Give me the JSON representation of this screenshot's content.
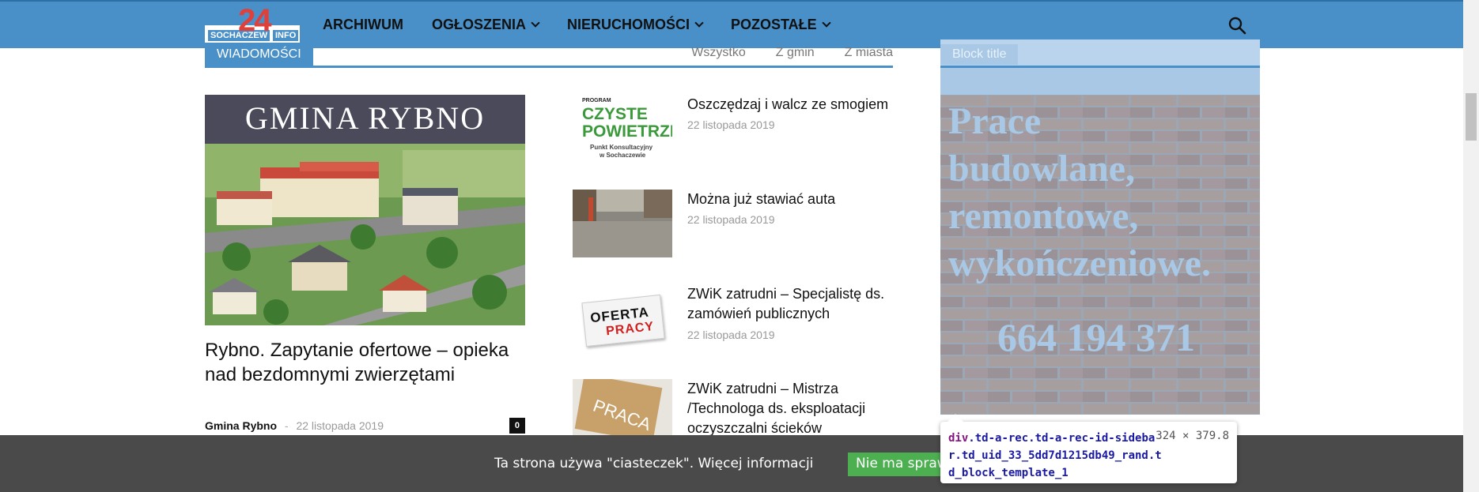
{
  "nav": {
    "logo_number": "24",
    "logo_left": "SOCHACZEW",
    "logo_right": "INFO",
    "items": [
      {
        "label": "ARCHIWUM",
        "dropdown": false
      },
      {
        "label": "OGŁOSZENIA",
        "dropdown": true
      },
      {
        "label": "NIERUCHOMOŚCI",
        "dropdown": true
      },
      {
        "label": "POZOSTAŁE",
        "dropdown": true
      }
    ]
  },
  "section": {
    "tag": "WIADOMOŚCI",
    "filters": [
      "Wszystko",
      "Z gmin",
      "Z miasta"
    ]
  },
  "main_article": {
    "image_caption": "GMINA RYBNO",
    "title": "Rybno. Zapytanie ofertowe – opieka nad bezdomnymi zwierzętami",
    "author": "Gmina Rybno",
    "separator": "-",
    "date": "22 listopada 2019",
    "comments": "0"
  },
  "list": [
    {
      "title": "Oszczędzaj i walcz ze smogiem",
      "date": "22 listopada 2019",
      "thumb_text": [
        "PROGRAM",
        "CZYSTE",
        "POWIETRZE",
        "Punkt Konsultacyjny",
        "w Sochaczewie"
      ]
    },
    {
      "title": "Można już stawiać auta",
      "date": "22 listopada 2019"
    },
    {
      "title": "ZWiK zatrudni – Specjalistę ds. zamówień publicznych",
      "date": "22 listopada 2019",
      "thumb_text": [
        "OFERTA",
        "PRACY"
      ]
    },
    {
      "title": "ZWiK zatrudni – Mistrza /Technologa ds. eksploatacji oczyszczalni ścieków",
      "date": "",
      "thumb_text": [
        "PRACA"
      ]
    }
  ],
  "sidebar": {
    "block_title": "Block title",
    "ad_lines": [
      "Prace",
      "budowlane,",
      "remontowe,",
      "wykończeniowe."
    ],
    "ad_phone": "664 194 371"
  },
  "cookie": {
    "text": "Ta strona używa \"ciasteczek\". Więcej informacji",
    "button": "Nie ma sprawy"
  },
  "devtools_tooltip": {
    "tag": "div",
    "selector": ".td-a-rec.td-a-rec-id-sidebar.td_uid_33_5dd7d1215db49_rand.td_block_template_1",
    "size": "324 × 379.8"
  },
  "colors": {
    "brand_blue": "#4a90c8",
    "logo_red": "#e0403a",
    "cookie_bg": "#4a4a4a",
    "cookie_button": "#4caf50"
  }
}
